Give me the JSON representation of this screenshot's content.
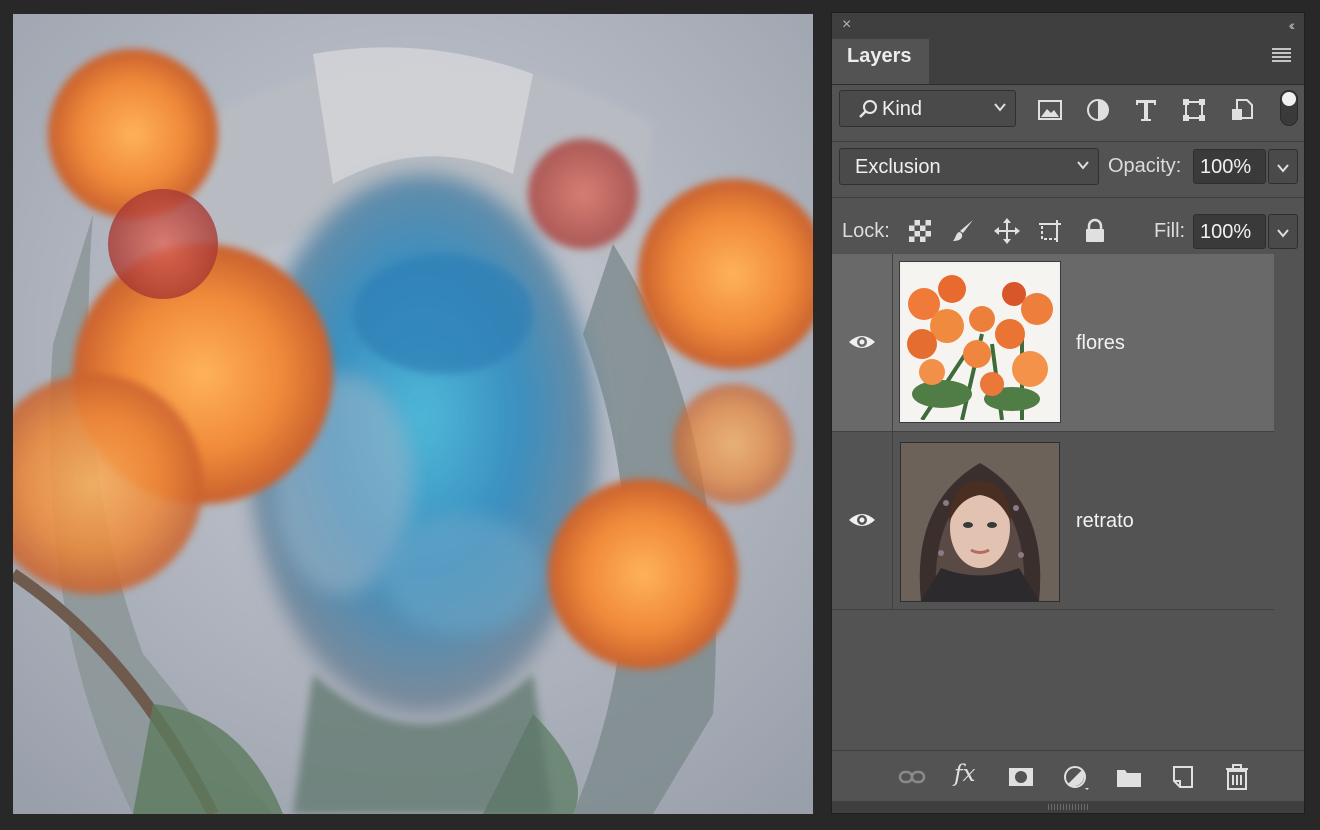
{
  "panel": {
    "tab_label": "Layers",
    "close_glyph": "×",
    "collapse_glyph": "‹‹"
  },
  "filter": {
    "kind_label": "Kind",
    "icons": [
      "image-filter-icon",
      "adjustment-filter-icon",
      "type-filter-icon",
      "shape-filter-icon",
      "smart-object-filter-icon"
    ],
    "toggle_on": true
  },
  "blend": {
    "mode": "Exclusion",
    "opacity_label": "Opacity:",
    "opacity_value": "100%"
  },
  "lock": {
    "label": "Lock:",
    "icons": [
      "lock-transparent-pixels-icon",
      "lock-image-pixels-icon",
      "lock-position-icon",
      "lock-artboard-icon",
      "lock-all-icon"
    ],
    "fill_label": "Fill:",
    "fill_value": "100%"
  },
  "layers": [
    {
      "name": "flores",
      "visible": true,
      "selected": true
    },
    {
      "name": "retrato",
      "visible": true,
      "selected": false
    }
  ],
  "bottom_bar": {
    "fx_label": "fx",
    "icons": [
      "link-layers-icon",
      "layer-style-icon",
      "add-mask-icon",
      "adjustment-layer-icon",
      "new-group-icon",
      "new-layer-icon",
      "delete-layer-icon"
    ]
  },
  "colors": {
    "panel_bg": "#535353",
    "selected_row": "#696969",
    "app_bg": "#282828"
  }
}
